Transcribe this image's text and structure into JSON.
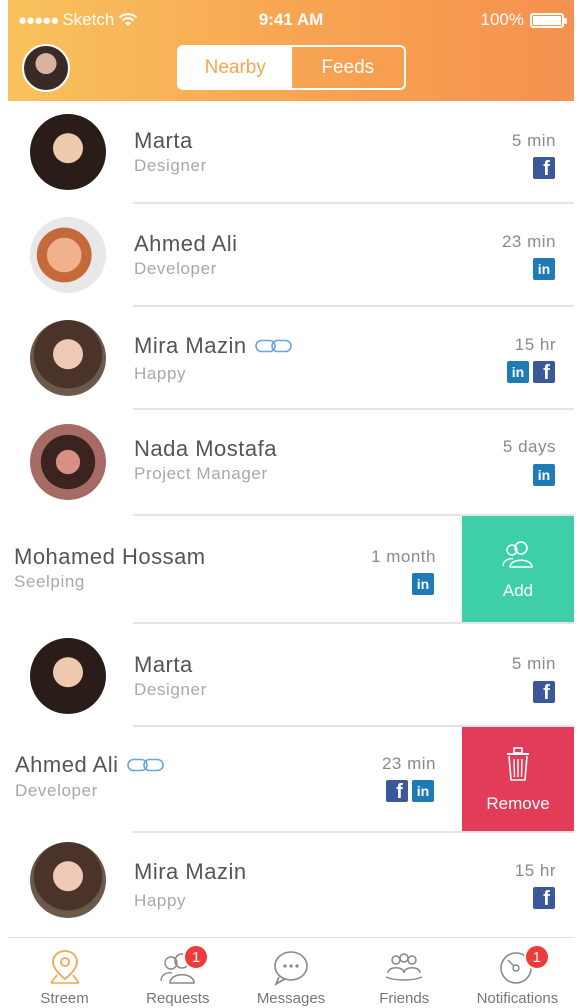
{
  "status_bar": {
    "carrier": "Sketch",
    "time": "9:41 AM",
    "battery": "100%",
    "battery_level": 1.0
  },
  "header": {
    "segments": [
      "Nearby",
      "Feeds"
    ],
    "selected_segment": "Nearby"
  },
  "list": {
    "rows": [
      {
        "name": "Marta",
        "subtitle": "Designer",
        "time": "5 min",
        "socials": [
          "facebook"
        ],
        "linked": false
      },
      {
        "name": "Ahmed Ali",
        "subtitle": "Developer",
        "time": "23 min",
        "socials": [
          "linkedin"
        ],
        "linked": false
      },
      {
        "name": "Mira Mazin",
        "subtitle": "Happy",
        "time": "15 hr",
        "socials": [
          "linkedin",
          "facebook"
        ],
        "linked": true
      },
      {
        "name": "Nada Mostafa",
        "subtitle": "Project Manager",
        "time": "5 days",
        "socials": [
          "linkedin"
        ],
        "linked": false
      },
      {
        "name": "Mohamed Hossam",
        "subtitle": "Seelping",
        "time": "1 month",
        "socials": [
          "linkedin"
        ],
        "linked": false,
        "swipe_action": "Add"
      },
      {
        "name": "Marta",
        "subtitle": "Designer",
        "time": "5 min",
        "socials": [
          "facebook"
        ],
        "linked": false
      },
      {
        "name": "Ahmed Ali",
        "subtitle": "Developer",
        "time": "23 min",
        "socials": [
          "facebook",
          "linkedin"
        ],
        "linked": true,
        "swipe_action": "Remove"
      },
      {
        "name": "Mira Mazin",
        "subtitle": "Happy",
        "time": "15 hr",
        "socials": [
          "facebook"
        ],
        "linked": false
      }
    ],
    "actions": {
      "add": "Add",
      "remove": "Remove"
    }
  },
  "tabbar": {
    "tabs": [
      {
        "label": "Streem",
        "icon": "map-pin-icon"
      },
      {
        "label": "Requests",
        "icon": "people-icon",
        "badge": "1"
      },
      {
        "label": "Messages",
        "icon": "chat-bubble-icon"
      },
      {
        "label": "Friends",
        "icon": "friends-icon"
      },
      {
        "label": "Notifications",
        "icon": "bell-icon",
        "badge": "1"
      }
    ]
  },
  "colors": {
    "header_start": "#f9c25d",
    "header_end": "#f6914f",
    "accent": "#f6a54f",
    "add": "#3ecfa9",
    "remove": "#e33c58",
    "badge": "#ef3b3b",
    "facebook": "#3b5998",
    "linkedin": "#1f7bb6"
  }
}
